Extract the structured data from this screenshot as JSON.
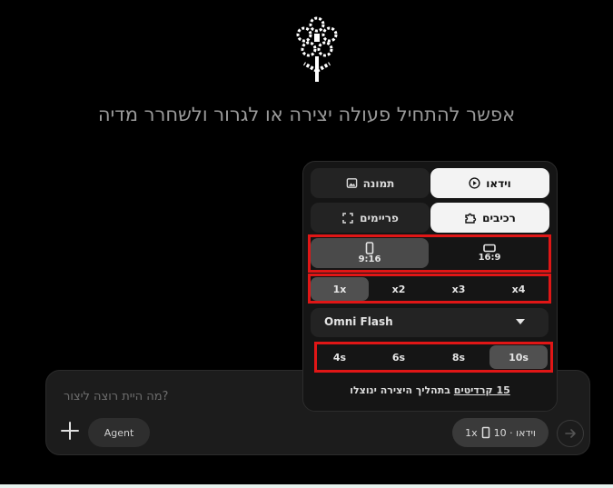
{
  "headline": "אפשר להתחיל פעולה יצירה או לגרור ולשחרר מדיה",
  "composer": {
    "placeholder": "?מה היית רוצה ליצור",
    "agent_label": "Agent",
    "chip_speed": "1x",
    "chip_mode": "וידאו · 10"
  },
  "panel": {
    "media_tabs": [
      {
        "label": "וידאו",
        "icon": "play-circle-icon",
        "selected": true
      },
      {
        "label": "תמונה",
        "icon": "image-icon",
        "selected": false
      }
    ],
    "source_tabs": [
      {
        "label": "רכיבים",
        "icon": "puzzle-icon",
        "selected": true
      },
      {
        "label": "פריימים",
        "icon": "frame-icon",
        "selected": false
      }
    ],
    "aspect_ratios": [
      {
        "label": "16:9",
        "selected": false
      },
      {
        "label": "9:16",
        "selected": true
      }
    ],
    "multipliers": [
      {
        "label": "x4",
        "selected": false
      },
      {
        "label": "x3",
        "selected": false
      },
      {
        "label": "x2",
        "selected": false
      },
      {
        "label": "1x",
        "selected": true
      }
    ],
    "model": "Omni Flash",
    "durations": [
      {
        "label": "10s",
        "selected": true
      },
      {
        "label": "8s",
        "selected": false
      },
      {
        "label": "6s",
        "selected": false
      },
      {
        "label": "4s",
        "selected": false
      }
    ],
    "credits_prefix": "בתהליך היצירה ינוצלו",
    "credits_link": "15 קרדיטים"
  },
  "colors": {
    "highlight": "#e01616",
    "selected_tab": "#f3f3f3",
    "background": "#000000"
  }
}
